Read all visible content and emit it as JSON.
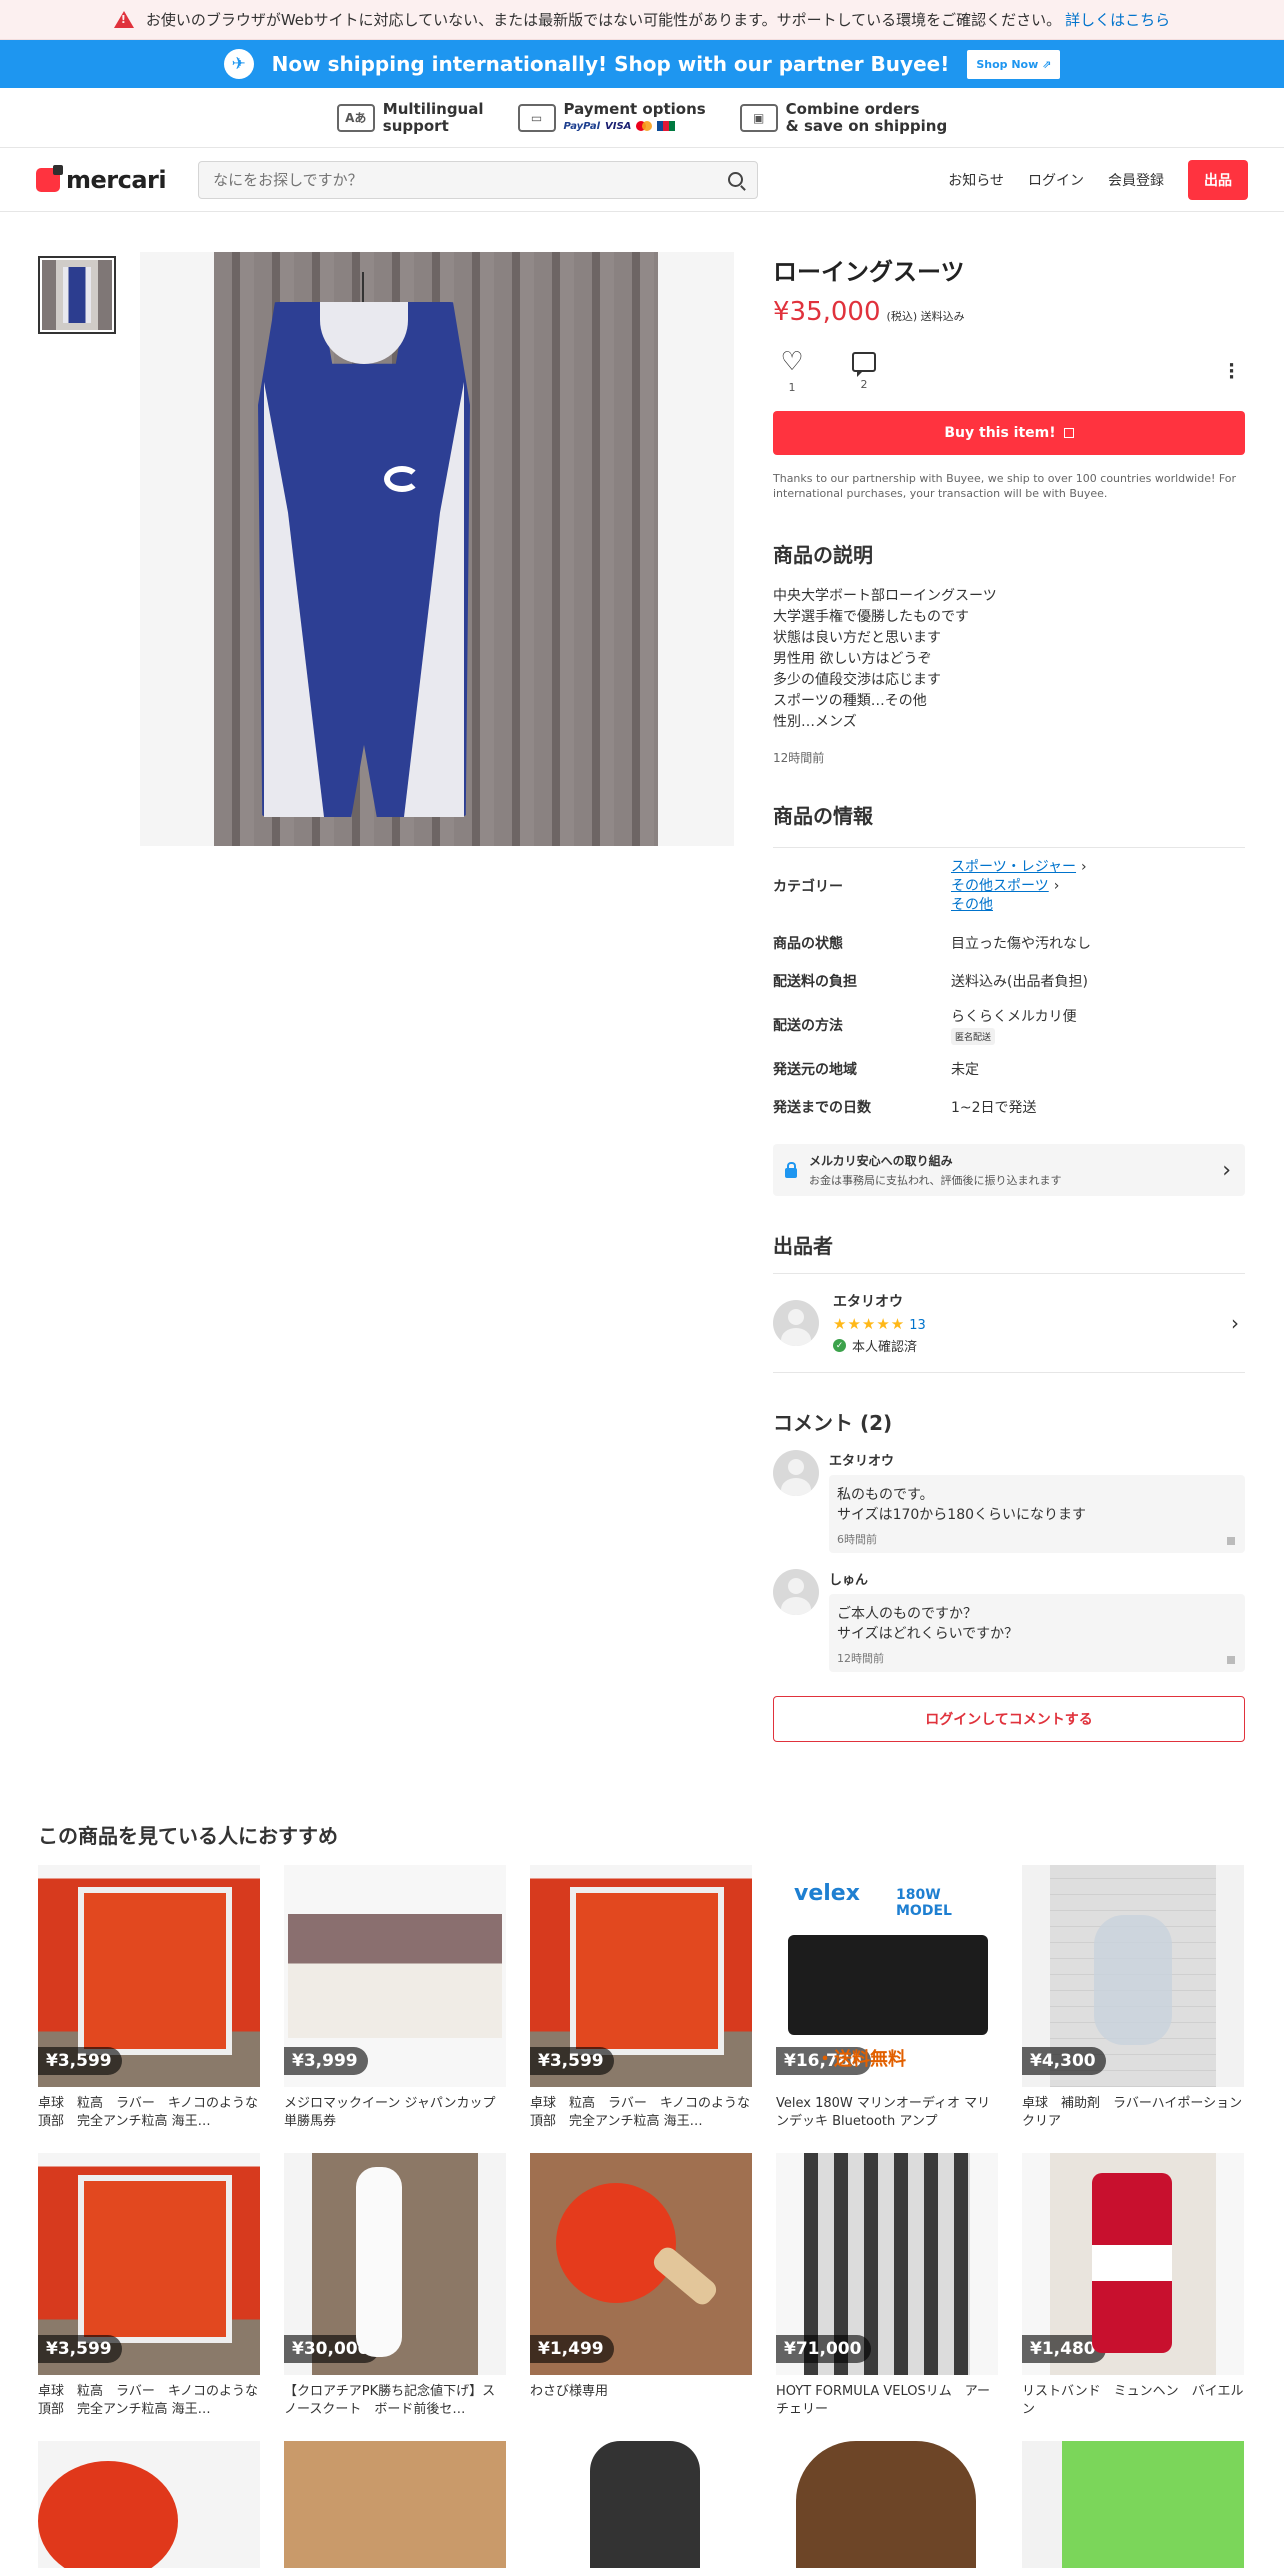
{
  "banner": {
    "warning_text": "お使いのブラウザがWebサイトに対応していない、または最新版ではない可能性があります。サポートしている環境をご確認ください。",
    "warning_link": "詳しくはこちら"
  },
  "shipping": {
    "message": "Now shipping internationally! Shop with our partner Buyee!",
    "button": "Shop Now"
  },
  "features": [
    {
      "line1": "Multilingual",
      "line2": "support",
      "icon": "translate-icon"
    },
    {
      "line1": "Payment options",
      "line2": "",
      "icon": "card-icon",
      "logos": [
        "PayPal",
        "VISA"
      ]
    },
    {
      "line1": "Combine orders",
      "line2": "& save on shipping",
      "icon": "box-icon"
    }
  ],
  "header": {
    "logo": "mercari",
    "search_placeholder": "なにをお探しですか？",
    "nav": [
      "お知らせ",
      "ログイン",
      "会員登録"
    ],
    "sell": "出品"
  },
  "product": {
    "title": "ローイングスーツ",
    "price": "¥35,000",
    "tax_note": "(税込) 送料込み",
    "likes": "1",
    "comments_count": "2",
    "buy_button": "Buy this item!",
    "buyee_note": "Thanks to our partnership with Buyee, we ship to over 100 countries worldwide! For international purchases, your transaction will be with Buyee.",
    "description_heading": "商品の説明",
    "description": [
      "中央大学ボート部ローイングスーツ",
      "大学選手権で優勝したものです",
      "状態は良い方だと思います",
      "男性用  欲しい方はどうぞ",
      "多少の値段交渉は応じます",
      "スポーツの種類…その他",
      "性別…メンズ"
    ],
    "posted_ago": "12時間前",
    "info_heading": "商品の情報",
    "info": {
      "category_label": "カテゴリー",
      "category_links": [
        "スポーツ・レジャー",
        "その他スポーツ",
        "その他"
      ],
      "condition_label": "商品の状態",
      "condition": "目立った傷や汚れなし",
      "shipping_cost_label": "配送料の負担",
      "shipping_cost": "送料込み(出品者負担)",
      "shipping_method_label": "配送の方法",
      "shipping_method": "らくらくメルカリ便",
      "shipping_method_tag": "匿名配送",
      "origin_label": "発送元の地域",
      "origin": "未定",
      "days_label": "発送までの日数",
      "days": "1~2日で発送"
    },
    "safety_title": "メルカリ安心への取り組み",
    "safety_text": "お金は事務局に支払われ、評価後に振り込まれます"
  },
  "seller": {
    "heading": "出品者",
    "name": "エタリオウ",
    "stars": "★★★★★",
    "rating_count": "13",
    "verified": "本人確認済"
  },
  "comments": {
    "heading": "コメント (2)",
    "items": [
      {
        "name": "エタリオウ",
        "line1": "私のものです。",
        "line2": "サイズは170から180くらいになります",
        "time": "6時間前"
      },
      {
        "name": "しゅん",
        "line1": "ご本人のものですか？",
        "line2": "サイズはどれくらいですか？",
        "time": "12時間前"
      }
    ],
    "login_button": "ログインしてコメントする"
  },
  "recommendations": {
    "heading": "この商品を見ている人におすすめ",
    "items": [
      {
        "price": "¥3,599",
        "title": "卓球　粒高　ラバー　キノコのような頂部　完全アンチ粒高 海王…"
      },
      {
        "price": "¥3,999",
        "title": "メジロマックイーン ジャパンカップ 単勝馬券"
      },
      {
        "price": "¥3,599",
        "title": "卓球　粒高　ラバー　キノコのような頂部　完全アンチ粒高 海王…"
      },
      {
        "price": "¥16,780",
        "title": "Velex 180W マリンオーディオ マリンデッキ Bluetooth アンプ",
        "brand": "velex",
        "model": "180W MODEL",
        "promo": "・送料無料"
      },
      {
        "price": "¥4,300",
        "title": "卓球　補助剤　ラバーハイポーション　クリア"
      },
      {
        "price": "¥3,599",
        "title": "卓球　粒高　ラバー　キノコのような頂部　完全アンチ粒高 海王…"
      },
      {
        "price": "¥30,000",
        "title": "【クロアチアPK勝ち記念値下げ】スノースクート　ボード前後セ…"
      },
      {
        "price": "¥1,499",
        "title": "わさび様専用"
      },
      {
        "price": "¥71,000",
        "title": "HOYT FORMULA VELOSリム　アーチェリー"
      },
      {
        "price": "¥1,480",
        "title": "リストバンド　ミュンヘン　バイエルン"
      }
    ]
  }
}
